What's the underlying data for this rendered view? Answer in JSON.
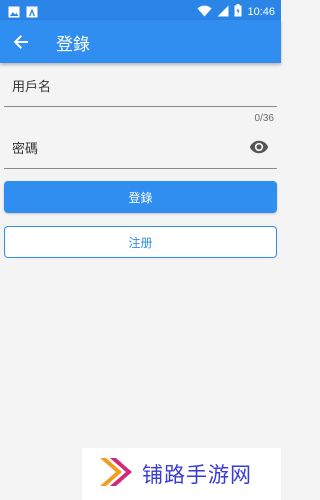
{
  "status_bar": {
    "time": "10:46"
  },
  "app_bar": {
    "title": "登錄",
    "back_icon": "arrow-back-icon"
  },
  "form": {
    "username_label": "用戶名",
    "password_label": "密碼",
    "password_counter": "0/36",
    "visibility_icon": "eye-icon"
  },
  "buttons": {
    "login": "登錄",
    "register": "注册"
  },
  "watermark": {
    "text": "铺路手游网"
  },
  "colors": {
    "primary": "#2f8ef0",
    "status_bar": "#2a85e6",
    "background": "#f4f4f4",
    "watermark_text": "#3a3ad8"
  }
}
